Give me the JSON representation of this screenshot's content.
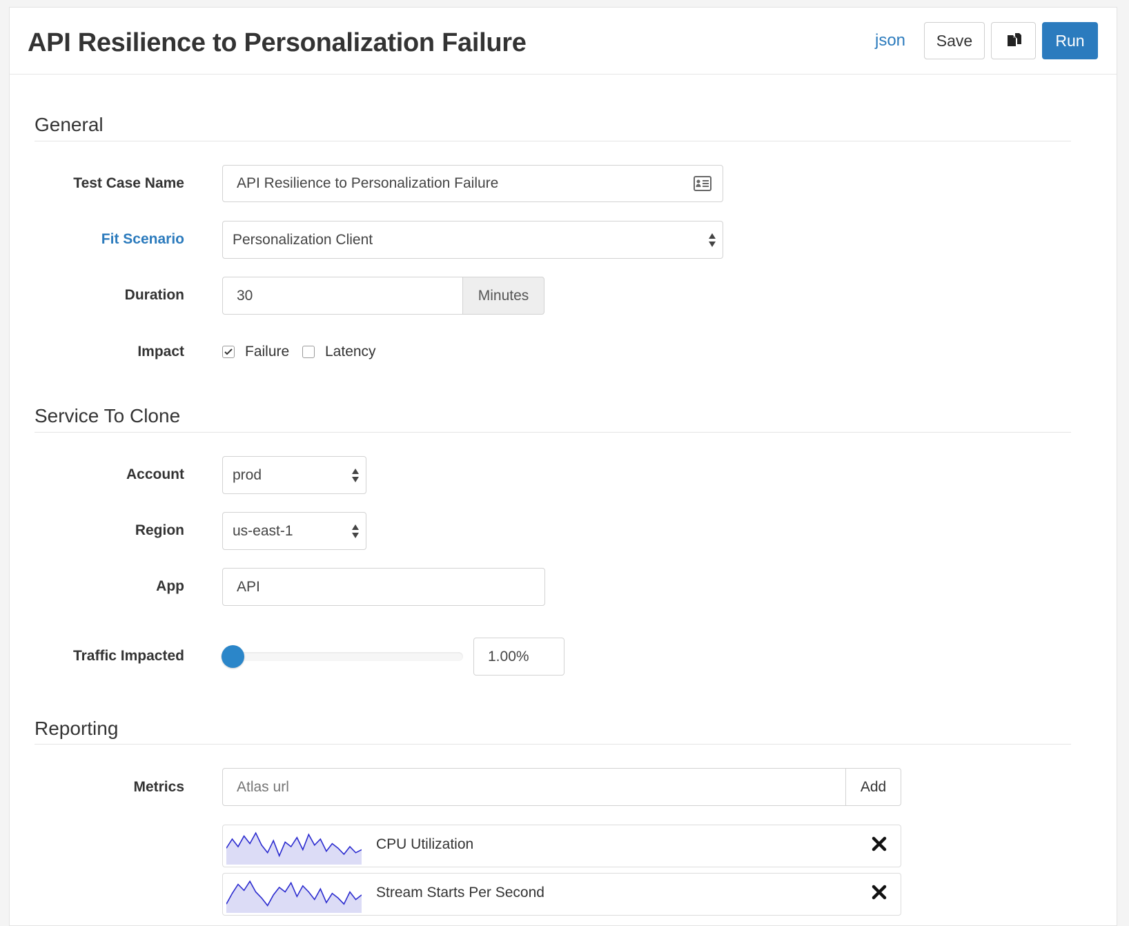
{
  "header": {
    "title": "API Resilience to Personalization Failure",
    "json_link": "json",
    "save_label": "Save",
    "copy_icon": "copy-icon",
    "run_label": "Run",
    "accent_color": "#2b7bbe"
  },
  "general": {
    "section_title": "General",
    "test_case_name": {
      "label": "Test Case Name",
      "value": "API Resilience to Personalization Failure",
      "icon": "id-card-icon"
    },
    "fit_scenario": {
      "label": "Fit Scenario",
      "value": "Personalization Client"
    },
    "duration": {
      "label": "Duration",
      "value": "30",
      "unit": "Minutes"
    },
    "impact": {
      "label": "Impact",
      "options": [
        {
          "label": "Failure",
          "checked": true
        },
        {
          "label": "Latency",
          "checked": false
        }
      ]
    }
  },
  "service_to_clone": {
    "section_title": "Service To Clone",
    "account": {
      "label": "Account",
      "value": "prod"
    },
    "region": {
      "label": "Region",
      "value": "us-east-1"
    },
    "app": {
      "label": "App",
      "value": "API"
    },
    "traffic": {
      "label": "Traffic Impacted",
      "value": "1.00%",
      "slider_fraction": 0.01
    }
  },
  "reporting": {
    "section_title": "Reporting",
    "metrics_label": "Metrics",
    "metrics_placeholder": "Atlas url",
    "add_label": "Add",
    "metrics": [
      {
        "name": "CPU Utilization",
        "sparkline": [
          0.45,
          0.75,
          0.5,
          0.85,
          0.6,
          0.95,
          0.55,
          0.3,
          0.7,
          0.2,
          0.65,
          0.5,
          0.8,
          0.4,
          0.9,
          0.55,
          0.75,
          0.35,
          0.6,
          0.45,
          0.25,
          0.5,
          0.3,
          0.4
        ]
      },
      {
        "name": "Stream Starts Per Second",
        "sparkline": [
          0.2,
          0.55,
          0.85,
          0.65,
          0.95,
          0.6,
          0.4,
          0.15,
          0.5,
          0.75,
          0.6,
          0.9,
          0.45,
          0.8,
          0.6,
          0.35,
          0.7,
          0.25,
          0.55,
          0.4,
          0.2,
          0.6,
          0.35,
          0.5
        ]
      }
    ]
  }
}
